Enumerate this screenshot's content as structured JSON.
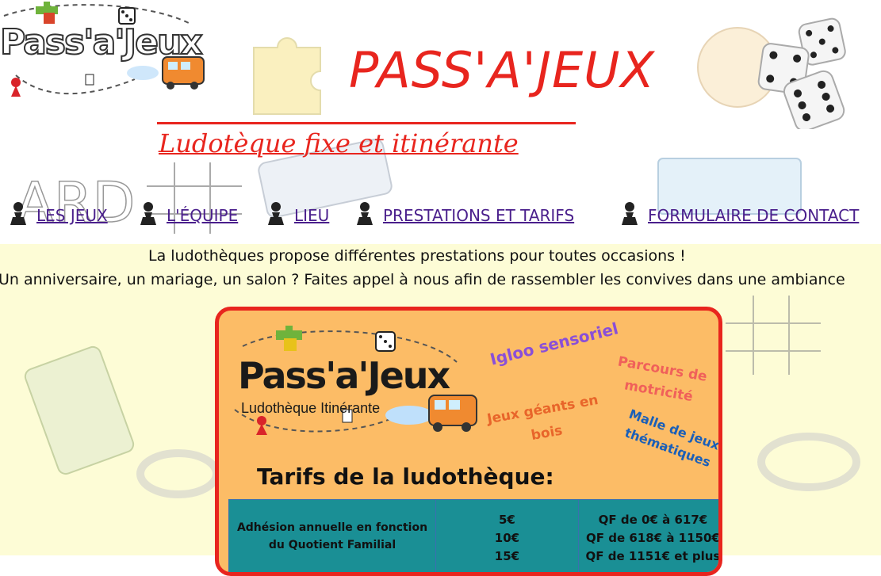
{
  "site": {
    "logo_text": "Pass'a'Jeux",
    "title": "PASS'A'JEUX",
    "subtitle": "Ludotèque fixe et itinérante"
  },
  "nav": {
    "items": [
      {
        "label": "LES JEUX"
      },
      {
        "label": "L'ÉQUIPE"
      },
      {
        "label": "LIEU"
      },
      {
        "label": "PRESTATIONS ET TARIFS"
      },
      {
        "label": "FORMULAIRE DE CONTACT"
      }
    ]
  },
  "intro": {
    "line1": "La ludothèques propose différentes prestations pour toutes occasions !",
    "line2": "Un anniversaire, un mariage, un salon ? Faites appel à nous afin de rassembler les convives dans une ambiance"
  },
  "flyer": {
    "logo_text": "Pass'a'Jeux",
    "logo_sub": "Ludothèque Itinérante",
    "tags": {
      "igloo": "Igloo sensoriel",
      "parcours_1": "Parcours de",
      "parcours_2": "motricité",
      "geants_1": "Jeux géants en",
      "geants_2": "bois",
      "malle_1": "Malle de jeux",
      "malle_2": "thématiques"
    },
    "title": "Tarifs de la ludothèque:",
    "table": {
      "row1": {
        "label_1": "Adhésion annuelle en fonction",
        "label_2": "du Quotient Familial",
        "prices": [
          "5€",
          "10€",
          "15€"
        ],
        "brackets": [
          "QF de 0€ à 617€",
          "QF de 618€ à 1150€",
          "QF de 1151€ et plus"
        ]
      }
    }
  },
  "colors": {
    "brand_red": "#e8251e",
    "nav_link": "#4a1f8c",
    "flyer_bg": "#fcbc66",
    "table_bg": "#1a8f95",
    "lower_bg": "#fdfcd6"
  }
}
